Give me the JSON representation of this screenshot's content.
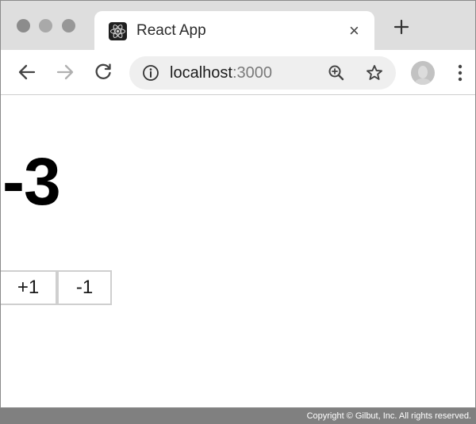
{
  "window": {
    "controls": [
      "close-dot",
      "minimize-dot",
      "zoom-dot"
    ]
  },
  "tab": {
    "title": "React App",
    "favicon": "react-logo-icon",
    "close_label": "×"
  },
  "new_tab": {
    "icon": "plus-icon"
  },
  "toolbar": {
    "back_icon": "arrow-left-icon",
    "forward_icon": "arrow-right-icon",
    "reload_icon": "reload-icon",
    "menu_icon": "kebab-menu-icon"
  },
  "omnibox": {
    "info_icon": "info-icon",
    "url_host": "localhost",
    "url_port": ":3000",
    "zoom_icon": "zoom-in-icon",
    "bookmark_icon": "star-icon"
  },
  "page": {
    "counter": "-3",
    "increment_label": "+1",
    "decrement_label": "-1"
  },
  "footer": {
    "copyright": "Copyright © Gilbut, Inc. All rights reserved."
  }
}
